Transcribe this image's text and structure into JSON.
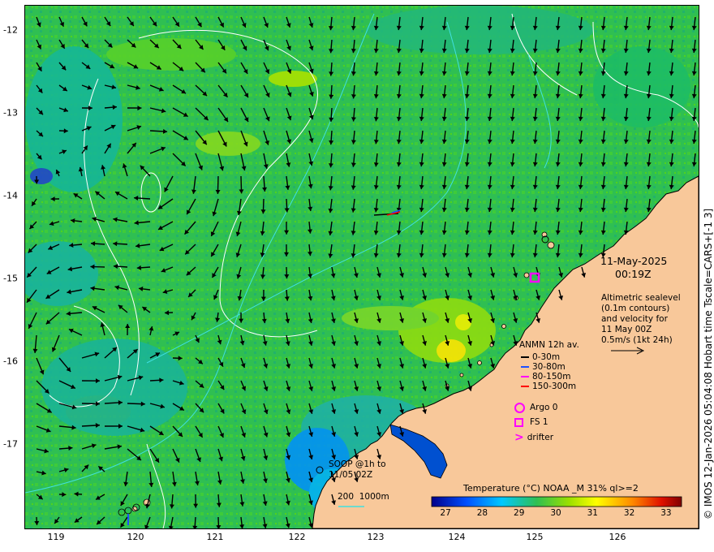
{
  "x_ticks": [
    "119",
    "120",
    "121",
    "122",
    "123",
    "124",
    "125",
    "126"
  ],
  "y_ticks": [
    "-12",
    "-13",
    "-14",
    "-15",
    "-16",
    "-17"
  ],
  "date_line": "11-May-2025",
  "time_line": "00:19Z",
  "altimetry_note": "Altimetric sealevel\n(0.1m contours)\nand velocity for\n11 May 00Z",
  "scale_arrow_label": "0.5m/s (1kt 24h)",
  "anmn_title": "ANMN 12h av.",
  "anmn_legend": [
    {
      "label": "0-30m",
      "color": "#000000"
    },
    {
      "label": "30-80m",
      "color": "#1e50ff"
    },
    {
      "label": "80-150m",
      "color": "#ff00ff"
    },
    {
      "label": "150-300m",
      "color": "#ff0000"
    }
  ],
  "symbols": [
    {
      "label": "Argo 0",
      "icon": "circle-icon",
      "color": "#ff00ff"
    },
    {
      "label": "FS 1",
      "icon": "square-icon",
      "color": "#ff00ff"
    },
    {
      "label": "drifter",
      "icon": "chevron-icon",
      "color": "#ff00ff"
    }
  ],
  "soop_note": "SOOP @1h to\n11/05 02Z",
  "isobath_label": "200  1000m",
  "colorbar": {
    "title": "Temperature (°C) NOAA _M 31% ql>=2",
    "ticks": [
      "27",
      "28",
      "29",
      "30",
      "31",
      "32",
      "33"
    ],
    "range": [
      26.6,
      33.4
    ]
  },
  "side_credit": "© IMOS 12-Jan-2026 05:04:08 Hobart time Tscale=CARS+[-1 3]",
  "colors": {
    "land": "#f8c89a",
    "sea_base": "#2fbf52",
    "contour_white": "#ffffff",
    "contour_cyan": "#40e0e0"
  }
}
